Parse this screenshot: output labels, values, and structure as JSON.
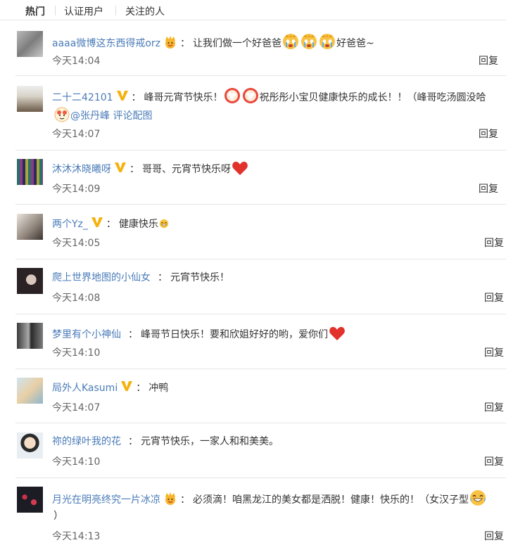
{
  "tabs": [
    "热门",
    "认证用户",
    "关注的人"
  ],
  "reply_label": "回复",
  "comments": [
    {
      "user": "aaaa微博这东西得戒orz",
      "text_a": "让我们做一个好爸爸",
      "text_b": "好爸爸~",
      "time": "今天14:04"
    },
    {
      "user": "二十二42101",
      "text_a": "峰哥元宵节快乐！",
      "text_b": "祝彤彤小宝贝健康快乐的成长！！（峰哥吃汤圆没哈",
      "mention": "@张丹峰",
      "pic_label": "评论配图",
      "time": "今天14:07"
    },
    {
      "user": "沐沐沐晓曦呀",
      "text_a": "哥哥、元宵节快乐呀",
      "time": "今天14:09"
    },
    {
      "user": "两个Yz_",
      "text_a": "健康快乐",
      "time": "今天14:05"
    },
    {
      "user": "爬上世界地图的小仙女",
      "text_a": "元宵节快乐！",
      "time": "今天14:08"
    },
    {
      "user": "梦里有个小神仙",
      "text_a": "峰哥节日快乐！要和欣姐好好的哟，爱你们",
      "time": "今天14:10"
    },
    {
      "user": "局外人Kasumi",
      "text_a": "冲鸭",
      "time": "今天14:07"
    },
    {
      "user": "祢的绿叶我的花",
      "text_a": "元宵节快乐，一家人和和美美。",
      "time": "今天14:10"
    },
    {
      "user": "月光在明亮终究一片冰凉",
      "text_a": "必须滴！咱黑龙江的美女都是洒脱！健康！快乐的！（女汉子型",
      "text_b": "）",
      "time": "今天14:13"
    }
  ]
}
